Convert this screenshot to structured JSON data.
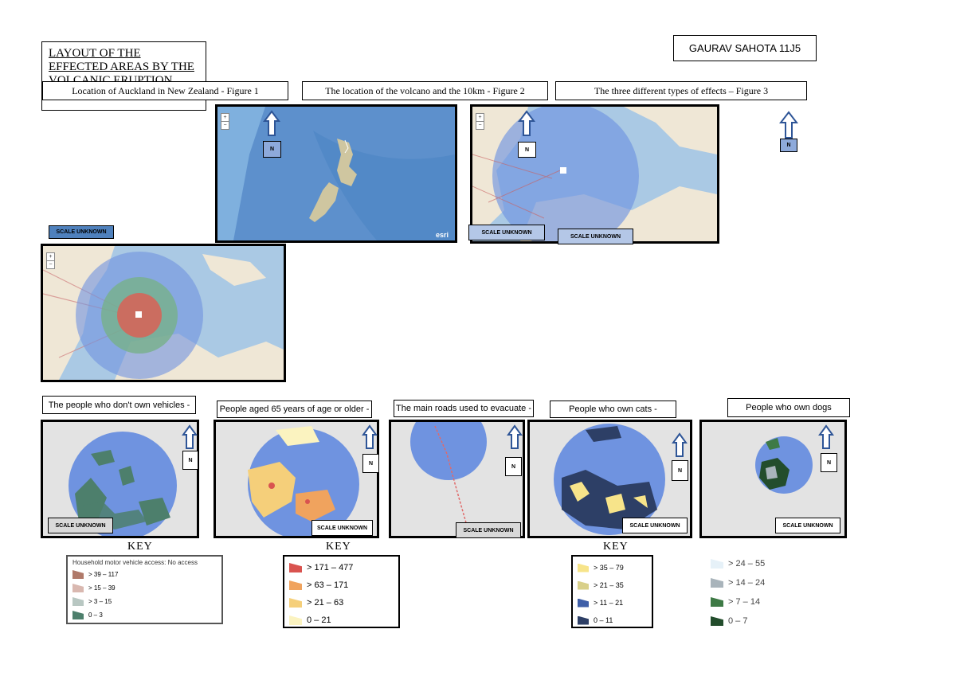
{
  "title": "LAYOUT OF THE EFFECTED AREAS BY THE VOLCANIC ERUPTION",
  "author": "GAURAV SAHOTA 11J5",
  "figures": {
    "fig1_caption": "Location of Auckland in New Zealand - Figure 1",
    "fig2_caption": "The location of the volcano and the 10km - Figure 2",
    "fig3_caption": "The three different types of effects – Figure 3"
  },
  "north_label": "N",
  "scale_label": "SCALE UNKNOWN",
  "esri_label": "esri",
  "panels": {
    "vehicles": "The people who don't own vehicles -",
    "age": "People aged 65 years of age or older -",
    "roads": "The main roads used to evacuate -",
    "cats": "People who own cats  -",
    "dogs": "People who own dogs"
  },
  "key_label": "KEY",
  "legends": {
    "vehicles": {
      "title": "Household motor vehicle access: No access",
      "items": [
        {
          "label": "> 39 – 117",
          "color": "#b07a6a"
        },
        {
          "label": "> 15 – 39",
          "color": "#d9b8b0"
        },
        {
          "label": "> 3 – 15",
          "color": "#b8c7c2"
        },
        {
          "label": "0 – 3",
          "color": "#4d7f6c"
        }
      ]
    },
    "age": {
      "items": [
        {
          "label": "> 171 – 477",
          "color": "#d9534f"
        },
        {
          "label": "> 63 – 171",
          "color": "#f0a35e"
        },
        {
          "label": "> 21 – 63",
          "color": "#f5cf7a"
        },
        {
          "label": "0 – 21",
          "color": "#fbf3c0"
        }
      ]
    },
    "cats": {
      "items": [
        {
          "label": "> 35 – 79",
          "color": "#f7e48a"
        },
        {
          "label": "> 21 – 35",
          "color": "#d9d08a"
        },
        {
          "label": "> 11 – 21",
          "color": "#3f5fa8"
        },
        {
          "label": "0 – 11",
          "color": "#2d3f66"
        }
      ]
    },
    "dogs": {
      "items": [
        {
          "label": "> 24 – 55",
          "color": "#e6f1f8"
        },
        {
          "label": "> 14 – 24",
          "color": "#a9b4bb"
        },
        {
          "label": "> 7 – 14",
          "color": "#3e7a46"
        },
        {
          "label": "0 – 7",
          "color": "#234d2c"
        }
      ]
    }
  },
  "colors": {
    "ocean": "#a9c9e6",
    "land": "#f1ece0",
    "radius": "#6f93e0",
    "grey_land": "#dcdcdc",
    "road": "#e06a6a"
  }
}
